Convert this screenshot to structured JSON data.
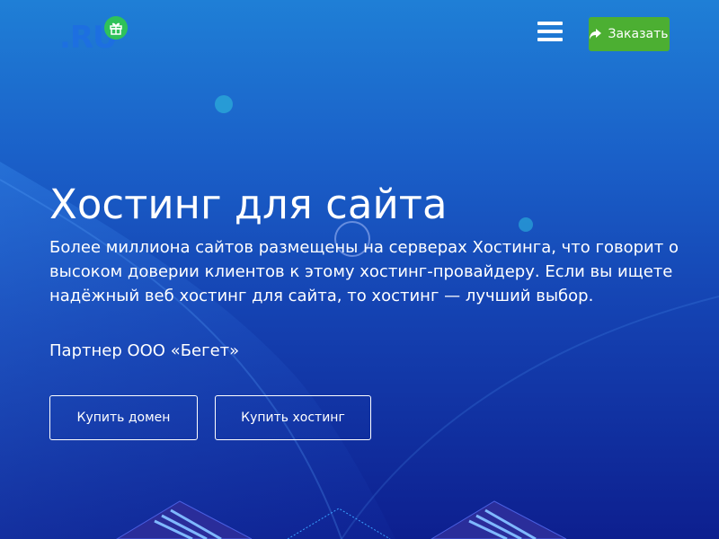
{
  "header": {
    "logo_text": ".RU",
    "order_button_label": "Заказать"
  },
  "hero": {
    "title": "Хостинг для сайта",
    "description": "Более миллиона сайтов размещены на серверах Хостинга, что говорит о высоком доверии клиентов к этому хостинг-провайдеру. Если вы ищете надёжный веб хостинг для сайта, то хостинг — лучший выбор.",
    "partner": "Партнер ООО «Бегет»",
    "buttons": {
      "buy_domain": "Купить домен",
      "buy_hosting": "Купить хостинг"
    }
  },
  "colors": {
    "order_button": "#4caf32",
    "gift_badge": "#2fc25a",
    "logo": "#1d6fe0"
  },
  "icons": [
    "gift-icon",
    "menu-icon",
    "share-icon"
  ]
}
